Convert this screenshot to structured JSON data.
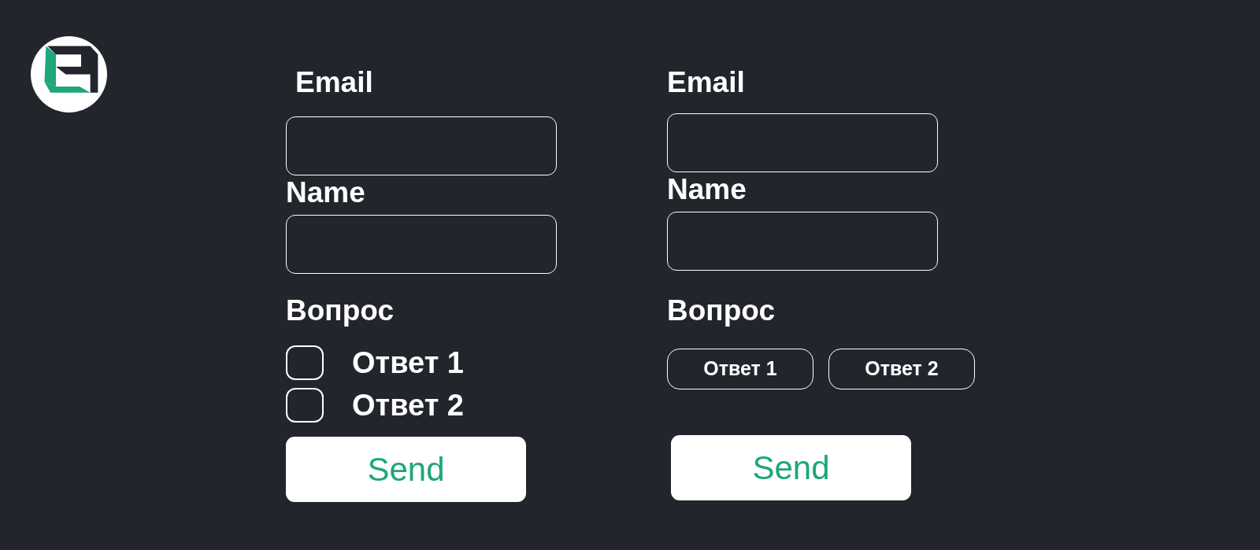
{
  "forms": [
    {
      "kind": "checkbox",
      "email_label": "Email",
      "name_label": "Name",
      "question": "Вопрос",
      "answers": [
        {
          "label": "Ответ 1",
          "checked": false
        },
        {
          "label": "Ответ 2",
          "checked": false
        }
      ],
      "submit": "Send"
    },
    {
      "kind": "chip",
      "email_label": "Email",
      "name_label": "Name",
      "question": "Вопрос",
      "answers": [
        {
          "label": "Ответ 1",
          "selected": false
        },
        {
          "label": "Ответ 2",
          "selected": false
        }
      ],
      "submit": "Send"
    }
  ]
}
